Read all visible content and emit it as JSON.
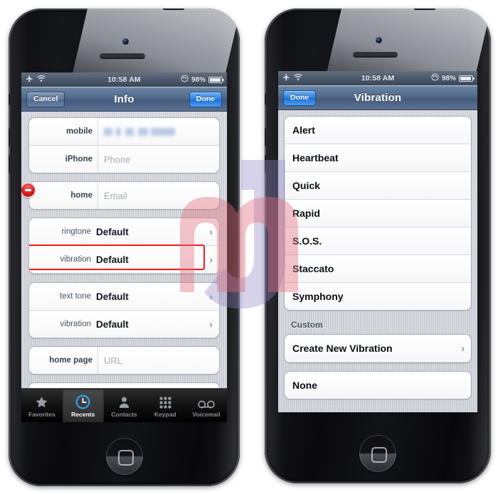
{
  "background_color": "#ffffff",
  "accent_colors": {
    "annotation_red": "#ee1b1b",
    "ios_blue": "#2c7fe0",
    "navbar_blue": "#4d6686",
    "tab_active": "#ffffff"
  },
  "watermark": {
    "text": "Jm",
    "colors": [
      "#e9a8ae",
      "#b9b2da"
    ]
  },
  "phones": [
    {
      "id": "left",
      "status_bar": {
        "airplane_icon": "airplane-icon",
        "wifi_icon": "wifi-icon",
        "time": "10:58 AM",
        "rotation_lock_icon": "rotation-lock-icon",
        "battery_percent": "98%"
      },
      "nav_bar": {
        "left_button": "Cancel",
        "title": "Info",
        "right_button": "Done"
      },
      "groups": [
        {
          "rows": [
            {
              "type": "field",
              "label": "mobile",
              "value": "",
              "blurred": true
            },
            {
              "type": "field",
              "label": "iPhone",
              "value": "Phone",
              "blurred": false
            }
          ]
        },
        {
          "rows": [
            {
              "type": "field",
              "label": "home",
              "value": "Email",
              "blurred": false
            }
          ]
        },
        {
          "rows": [
            {
              "type": "tone",
              "label": "ringtone",
              "value": "Default",
              "chevron": "›",
              "highlighted": false
            },
            {
              "type": "tone",
              "label": "vibration",
              "value": "Default",
              "chevron": "›",
              "highlighted": true
            }
          ]
        },
        {
          "rows": [
            {
              "type": "tone",
              "label": "text tone",
              "value": "Default",
              "chevron": "›",
              "highlighted": false
            },
            {
              "type": "tone",
              "label": "vibration",
              "value": "Default",
              "chevron": "›",
              "highlighted": false
            }
          ]
        },
        {
          "rows": [
            {
              "type": "field",
              "label": "home page",
              "value": "URL",
              "blurred": false
            }
          ]
        }
      ],
      "delete_badge": "remove-field-icon",
      "tab_bar": [
        {
          "label": "Favorites",
          "icon": "star-icon",
          "active": false
        },
        {
          "label": "Recents",
          "icon": "clock-icon",
          "active": true
        },
        {
          "label": "Contacts",
          "icon": "person-icon",
          "active": false
        },
        {
          "label": "Keypad",
          "icon": "keypad-icon",
          "active": false
        },
        {
          "label": "Voicemail",
          "icon": "voicemail-icon",
          "active": false
        }
      ]
    },
    {
      "id": "right",
      "status_bar": {
        "airplane_icon": "airplane-icon",
        "wifi_icon": "wifi-icon",
        "time": "10:58 AM",
        "rotation_lock_icon": "rotation-lock-icon",
        "battery_percent": "98%"
      },
      "nav_bar": {
        "left_button": "Done",
        "title": "Vibration",
        "right_button": ""
      },
      "standard_vibrations": [
        {
          "label": "Alert"
        },
        {
          "label": "Heartbeat"
        },
        {
          "label": "Quick"
        },
        {
          "label": "Rapid"
        },
        {
          "label": "S.O.S."
        },
        {
          "label": "Staccato"
        },
        {
          "label": "Symphony"
        }
      ],
      "custom_header": "Custom",
      "custom_rows": [
        {
          "label": "Create New Vibration",
          "chevron": "›",
          "highlighted": true
        }
      ],
      "none_rows": [
        {
          "label": "None",
          "chevron": "",
          "highlighted": false
        }
      ]
    }
  ]
}
